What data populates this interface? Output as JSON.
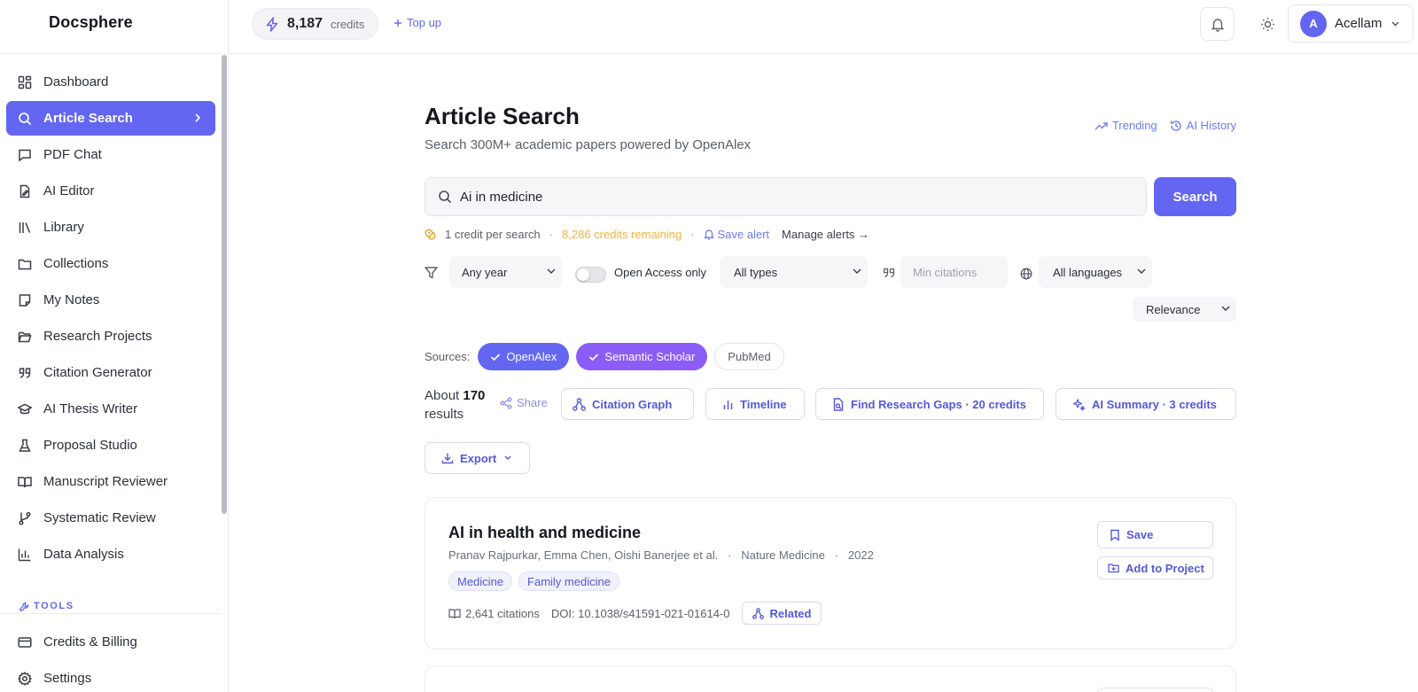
{
  "app": {
    "brand": "Docsphere"
  },
  "sidebar": {
    "items": [
      {
        "label": "Dashboard",
        "icon": "grid-icon"
      },
      {
        "label": "Article Search",
        "icon": "search-icon",
        "active": true
      },
      {
        "label": "PDF Chat",
        "icon": "chat-icon"
      },
      {
        "label": "AI Editor",
        "icon": "edit-doc-icon"
      },
      {
        "label": "Library",
        "icon": "library-icon"
      },
      {
        "label": "Collections",
        "icon": "folder-icon"
      },
      {
        "label": "My Notes",
        "icon": "note-icon"
      },
      {
        "label": "Research Projects",
        "icon": "folder-open-icon"
      },
      {
        "label": "Citation Generator",
        "icon": "quote-icon"
      },
      {
        "label": "AI Thesis Writer",
        "icon": "graduation-cap-icon"
      },
      {
        "label": "Proposal Studio",
        "icon": "flask-icon"
      },
      {
        "label": "Manuscript Reviewer",
        "icon": "book-open-icon"
      },
      {
        "label": "Systematic Review",
        "icon": "git-branch-icon"
      },
      {
        "label": "Data Analysis",
        "icon": "bar-chart-icon"
      }
    ],
    "tools_label": "TOOLS",
    "bottom_items": [
      {
        "label": "Credits & Billing",
        "icon": "credit-card-icon"
      },
      {
        "label": "Settings",
        "icon": "gear-icon"
      }
    ]
  },
  "topbar": {
    "credits_value": "8,187",
    "credits_unit": "credits",
    "topup_label": "Top up",
    "user_initial": "A",
    "user_name": "Acellam"
  },
  "main": {
    "title": "Article Search",
    "subtitle": "Search 300M+ academic papers powered by OpenAlex",
    "trending_label": "Trending",
    "history_label": "AI History",
    "search_value": "Ai in medicine",
    "search_button": "Search",
    "meta": {
      "cost": "1 credit per search",
      "remaining": "8,286 credits remaining",
      "save_alert": "Save alert",
      "manage_alerts": "Manage alerts →"
    },
    "filters": {
      "year": "Any year",
      "open_access_label": "Open Access only",
      "open_access_on": false,
      "type": "All types",
      "min_citations_placeholder": "Min citations",
      "language": "All languages"
    },
    "sort": "Relevance",
    "sources_label": "Sources:",
    "sources": [
      {
        "label": "OpenAlex",
        "selected": true
      },
      {
        "label": "Semantic Scholar",
        "selected": true
      },
      {
        "label": "PubMed",
        "selected": false
      }
    ],
    "results_prefix": "About",
    "results_count": "170",
    "results_suffix": "results",
    "share_label": "Share",
    "actions": {
      "citation_graph": "Citation Graph",
      "timeline": "Timeline",
      "research_gaps": "Find Research Gaps · 20 credits",
      "ai_summary": "AI Summary · 3 credits",
      "export": "Export"
    },
    "results": [
      {
        "title": "AI in health and medicine",
        "authors": "Pranav Rajpurkar, Emma Chen, Oishi Banerjee et al.",
        "journal": "Nature Medicine",
        "year": "2022",
        "tags": [
          "Medicine",
          "Family medicine"
        ],
        "citations": "2,641 citations",
        "doi": "DOI: 10.1038/s41591-021-01614-0",
        "related_label": "Related",
        "save_label": "Save",
        "add_to_project_label": "Add to Project"
      }
    ]
  },
  "colors": {
    "accent": "#6366f1",
    "purple": "#8b5cf6",
    "orange": "#f0b33a"
  }
}
